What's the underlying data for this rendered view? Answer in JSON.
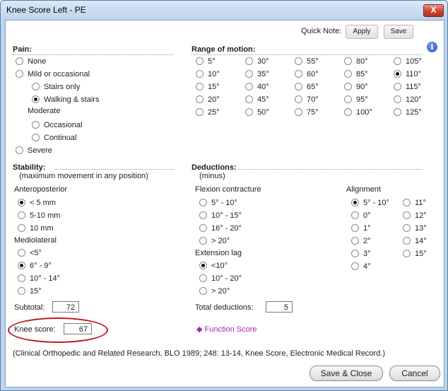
{
  "window": {
    "title": "Knee Score Left - PE",
    "close_label": "X"
  },
  "quick_note": {
    "label": "Quick Note:",
    "apply_label": "Apply",
    "save_label": "Save"
  },
  "info_icon": {
    "glyph": "i",
    "icon": "info-icon"
  },
  "pain": {
    "title": "Pain:",
    "none": "None",
    "mild": "Mild or occasional",
    "stairs_only": "Stairs only",
    "walking_stairs": "Walking & stairs",
    "moderate": "Moderate",
    "occasional": "Occasional",
    "continual": "Continual",
    "severe": "Severe",
    "selected": "Walking & stairs"
  },
  "range_of_motion": {
    "title": "Range of motion:",
    "options": [
      "5°",
      "10°",
      "15°",
      "20°",
      "25°",
      "30°",
      "35°",
      "40°",
      "45°",
      "50°",
      "55°",
      "60°",
      "65°",
      "70°",
      "75°",
      "80°",
      "85°",
      "90°",
      "95°",
      "100°",
      "105°",
      "110°",
      "115°",
      "120°",
      "125°"
    ],
    "selected": "110°"
  },
  "stability": {
    "title": "Stability:",
    "subtitle": "(maximum movement in any position)",
    "anteroposterior_label": "Anteroposterior",
    "anteroposterior": [
      "< 5 mm",
      "5-10 mm",
      "10 mm"
    ],
    "anteroposterior_selected": "< 5 mm",
    "mediolateral_label": "Mediolateral",
    "mediolateral": [
      "<5°",
      "6° - 9°",
      "10° - 14°",
      "15°"
    ],
    "mediolateral_selected": "6° - 9°",
    "subtotal_label": "Subtotal:",
    "subtotal_value": "72"
  },
  "deductions": {
    "title": "Deductions:",
    "subtitle": "(minus)",
    "flexion_label": "Flexion contracture",
    "flexion": [
      "5° - 10°",
      "10° - 15°",
      "16° - 20°",
      "> 20°"
    ],
    "extension_label": "Extension lag",
    "extension": [
      "<10°",
      "10° - 20°",
      "> 20°"
    ],
    "extension_selected": "<10°",
    "alignment_label": "Alignment",
    "alignment_col1": [
      "5° - 10°",
      "0°",
      "1°",
      "2°",
      "3°",
      "4°"
    ],
    "alignment_col2": [
      "11°",
      "12°",
      "13°",
      "14°",
      "15°"
    ],
    "alignment_selected": "5° - 10°",
    "total_label": "Total deductions:",
    "total_value": "5"
  },
  "knee_score": {
    "label": "Knee score:",
    "value": "67"
  },
  "function_score": {
    "label": "Function Score",
    "glyph": "◆",
    "icon": "diamond-icon",
    "color": "#a626b3"
  },
  "citation": "(Clinical Orthopedic and Related Research, BLO 1989; 248: 13-14, Knee Score, Electronic Medical Record.)",
  "footer": {
    "save_close": "Save & Close",
    "cancel": "Cancel"
  },
  "colors": {
    "highlight": "#c0171b",
    "window_frame": "#bcd4ee",
    "close_button": "#c8452f"
  }
}
